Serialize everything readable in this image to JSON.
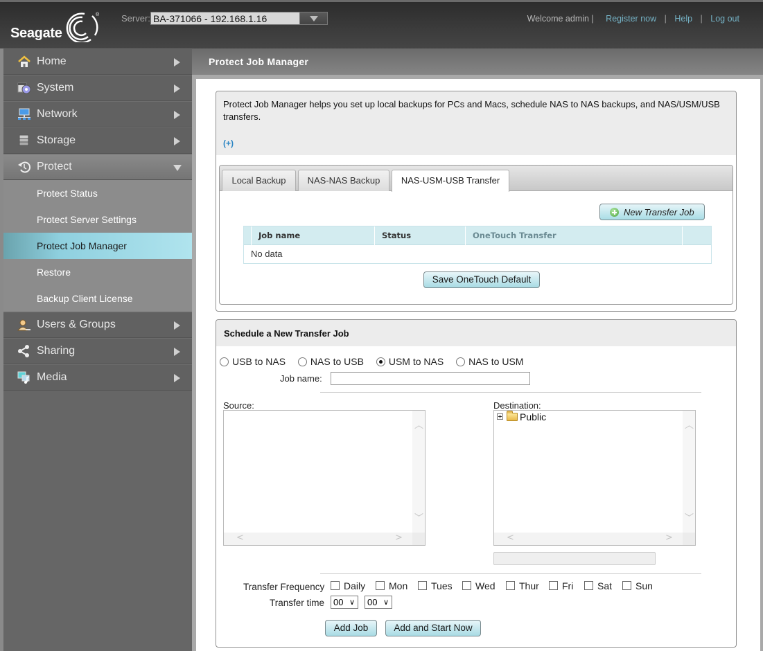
{
  "header": {
    "brand": "Seagate",
    "server_label": "Server:",
    "server_value": "BA-371066 - 192.168.1.16",
    "welcome": "Welcome admin |",
    "links": [
      "Register now",
      "Help",
      "Log out"
    ],
    "separator": "|"
  },
  "sidebar": {
    "items": [
      {
        "label": "Home",
        "icon": "home-icon"
      },
      {
        "label": "System",
        "icon": "system-gear-icon"
      },
      {
        "label": "Network",
        "icon": "network-icon"
      },
      {
        "label": "Storage",
        "icon": "storage-icon"
      },
      {
        "label": "Protect",
        "icon": "protect-icon",
        "expanded": true
      },
      {
        "label": "Users & Groups",
        "icon": "users-icon"
      },
      {
        "label": "Sharing",
        "icon": "share-icon"
      },
      {
        "label": "Media",
        "icon": "media-icon"
      }
    ],
    "protect_subitems": [
      {
        "label": "Protect Status"
      },
      {
        "label": "Protect Server Settings"
      },
      {
        "label": "Protect Job Manager",
        "active": true
      },
      {
        "label": "Restore"
      },
      {
        "label": "Backup Client License"
      }
    ]
  },
  "main": {
    "title": "Protect Job Manager",
    "intro": {
      "text": "Protect Job Manager helps you set up local backups for PCs and Macs, schedule NAS to NAS backups, and NAS/USM/USB transfers.",
      "more_link": "(+)"
    },
    "tabs": [
      {
        "label": "Local Backup"
      },
      {
        "label": "NAS-NAS Backup"
      },
      {
        "label": "NAS-USM-USB Transfer",
        "active": true
      }
    ],
    "new_job_button": "New Transfer Job",
    "table": {
      "columns": [
        "Job name",
        "Status",
        "OneTouch Transfer",
        ""
      ],
      "rows": [],
      "empty_text": "No data"
    },
    "save_onetouch_button": "Save OneTouch Default",
    "schedule": {
      "title": "Schedule a New Transfer Job",
      "directions": [
        {
          "label": "USB to NAS",
          "checked": false
        },
        {
          "label": "NAS to USB",
          "checked": false
        },
        {
          "label": "USM to NAS",
          "checked": true
        },
        {
          "label": "NAS to USM",
          "checked": false
        }
      ],
      "job_name_label": "Job name:",
      "job_name_value": "",
      "source_label": "Source:",
      "destination_label": "Destination:",
      "destination_tree": [
        {
          "label": "Public",
          "expandable": true
        }
      ],
      "destination_path": "",
      "frequency_label": "Transfer Frequency",
      "frequency_options": [
        {
          "label": "Daily",
          "checked": false
        },
        {
          "label": "Mon",
          "checked": false
        },
        {
          "label": "Tues",
          "checked": false
        },
        {
          "label": "Wed",
          "checked": false
        },
        {
          "label": "Thur",
          "checked": false
        },
        {
          "label": "Fri",
          "checked": false
        },
        {
          "label": "Sat",
          "checked": false
        },
        {
          "label": "Sun",
          "checked": false
        }
      ],
      "time_label": "Transfer time",
      "time_hour": "00",
      "time_minute": "00",
      "add_job_button": "Add Job",
      "add_start_button": "Add and Start Now"
    }
  },
  "colors": {
    "accent_link": "#74b1c4",
    "active_nav": "#8fd0df",
    "button_gradient_bottom": "#a8dbe4"
  }
}
